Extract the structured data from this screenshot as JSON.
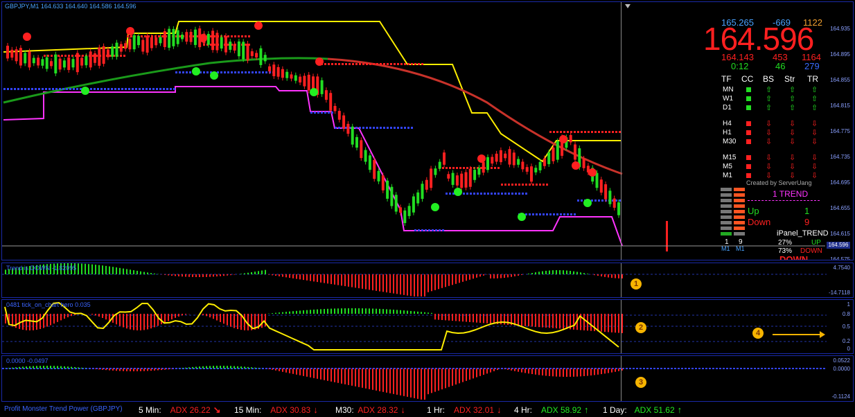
{
  "chart": {
    "symbol_line": "GBPJPY,M1  164.633 164.640 164.586 164.596",
    "price_axis": [
      "164.935",
      "164.895",
      "164.855",
      "164.815",
      "164.775",
      "164.735",
      "164.695",
      "164.655",
      "164.615",
      "164.575"
    ],
    "current_price_tag": "164.596"
  },
  "panel": {
    "top_left": "165.265",
    "top_mid": "-669",
    "top_right": "1122",
    "big_price": "164.596",
    "row2_left": "164.143",
    "row2_mid": "453",
    "row2_right": "1164",
    "row3_left": "0:12",
    "row3_mid": "46",
    "row3_right": "279",
    "headers": [
      "TF",
      "CC",
      "BS",
      "Str",
      "TR"
    ],
    "rows": [
      {
        "tf": "MN",
        "dir": "up"
      },
      {
        "tf": "W1",
        "dir": "up"
      },
      {
        "tf": "D1",
        "dir": "up"
      },
      {
        "tf": "H4",
        "dir": "down"
      },
      {
        "tf": "H1",
        "dir": "down"
      },
      {
        "tf": "M30",
        "dir": "down"
      },
      {
        "tf": "M15",
        "dir": "down"
      },
      {
        "tf": "M5",
        "dir": "down"
      },
      {
        "tf": "M1",
        "dir": "down"
      }
    ],
    "created_by": "Created by ServerUang",
    "trend_title": "1 TREND",
    "up_label": "Up",
    "up_value": "1",
    "down_label": "Down",
    "down_value": "9",
    "ipanel_title": "iPanel_TREND",
    "pct_up": "27%",
    "pct_up_label": "UP",
    "pct_down": "73%",
    "pct_down_label": "DOWN",
    "bar_labels": [
      "1",
      "9"
    ],
    "bar_tf": [
      "M1",
      "M1"
    ],
    "down_stamp": "DOWN"
  },
  "indicators": {
    "p1_label": "Trend is DOWN -1.82095",
    "p1_axis": [
      "4.7540",
      "-14.7118"
    ],
    "p2_label": "0481  tick_on_chart hero  0.035",
    "p2_axis": [
      "1",
      "0.8",
      "0.5",
      "0.2",
      "0"
    ],
    "p3_label": "0.0000  -0.0497",
    "p3_axis": [
      "0.0522",
      "0.0000",
      "-0.1124"
    ],
    "badges": [
      "1",
      "2",
      "3",
      "4"
    ]
  },
  "status": {
    "title": "Profit Monster Trend Power (GBPJPY)",
    "items": [
      {
        "tf": "5 Min:",
        "adx": "ADX 26.22",
        "dir": "↘",
        "color": "#ff2020"
      },
      {
        "tf": "15 Min:",
        "adx": "ADX 30.83",
        "dir": "↓",
        "color": "#ff2020"
      },
      {
        "tf": "M30:",
        "adx": "ADX 28.32",
        "dir": "↓",
        "color": "#ff2020"
      },
      {
        "tf": "1 Hr:",
        "adx": "ADX 32.01",
        "dir": "↓",
        "color": "#ff2020"
      },
      {
        "tf": "4 Hr:",
        "adx": "ADX 58.92",
        "dir": "↑",
        "color": "#22ee22"
      },
      {
        "tf": "1 Day:",
        "adx": "ADX 51.62",
        "dir": "↑",
        "color": "#22ee22"
      }
    ]
  },
  "colors": {
    "bull": "#22dd22",
    "bear": "#ff2020",
    "magenta": "#ff33ff",
    "yellow": "#ffee00",
    "green_ma": "#1a9a1a",
    "red_ma": "#c8322a",
    "blue_dots": "#3344ff",
    "red_dots": "#ff2020"
  }
}
